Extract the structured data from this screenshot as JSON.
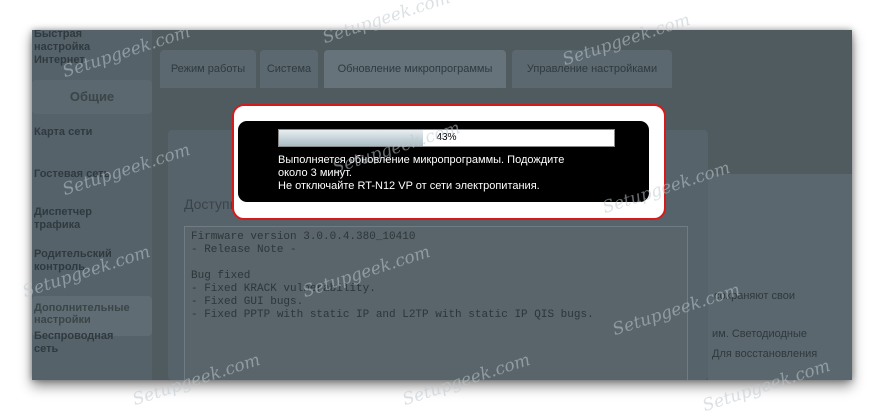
{
  "sidebar": {
    "top_item": [
      "Быстрая",
      "настройка",
      "Интернет"
    ],
    "section_general": "Общие",
    "items": [
      {
        "lines": [
          "Карта сети"
        ]
      },
      {
        "lines": [
          "Гостевая сеть"
        ]
      },
      {
        "lines": [
          "Диспетчер",
          "трафика"
        ]
      },
      {
        "lines": [
          "Родительский",
          "контроль"
        ]
      }
    ],
    "section_advanced": [
      "Дополнительные",
      "настройки"
    ],
    "advanced_items": [
      {
        "lines": [
          "Беспроводная",
          "сеть"
        ]
      }
    ]
  },
  "tabs": [
    {
      "label": "Режим работы"
    },
    {
      "label": "Система"
    },
    {
      "label": "Обновление микропрограммы"
    },
    {
      "label": "Управление настройками"
    }
  ],
  "panel": {
    "title": "Доступна новая версия микропрограммы",
    "release_notes": "Firmware version 3.0.0.4.380_10410\n- Release Note -\n\nBug fixed\n- Fixed KRACK vulnerability.\n- Fixed GUI bugs.\n- Fixed PPTP with static IP and L2TP with static IP QIS bugs."
  },
  "right_text": {
    "line1": "сохраняют свои",
    "line2": "им. Светодиодные",
    "line3": "Для восстановления"
  },
  "modal": {
    "progress_percent": 43,
    "progress_label": "43%",
    "message_line1": "Выполняется обновление микропрограммы. Подождите",
    "message_line2": "около 3 минут.",
    "message_line3": "Не отключайте RT-N12 VP от сети электропитания."
  },
  "watermark": "Setupgeek.com",
  "colors": {
    "highlight_border": "#d61a1a",
    "modal_bg": "#000000",
    "overlay_bg": "#4f5b5e"
  }
}
